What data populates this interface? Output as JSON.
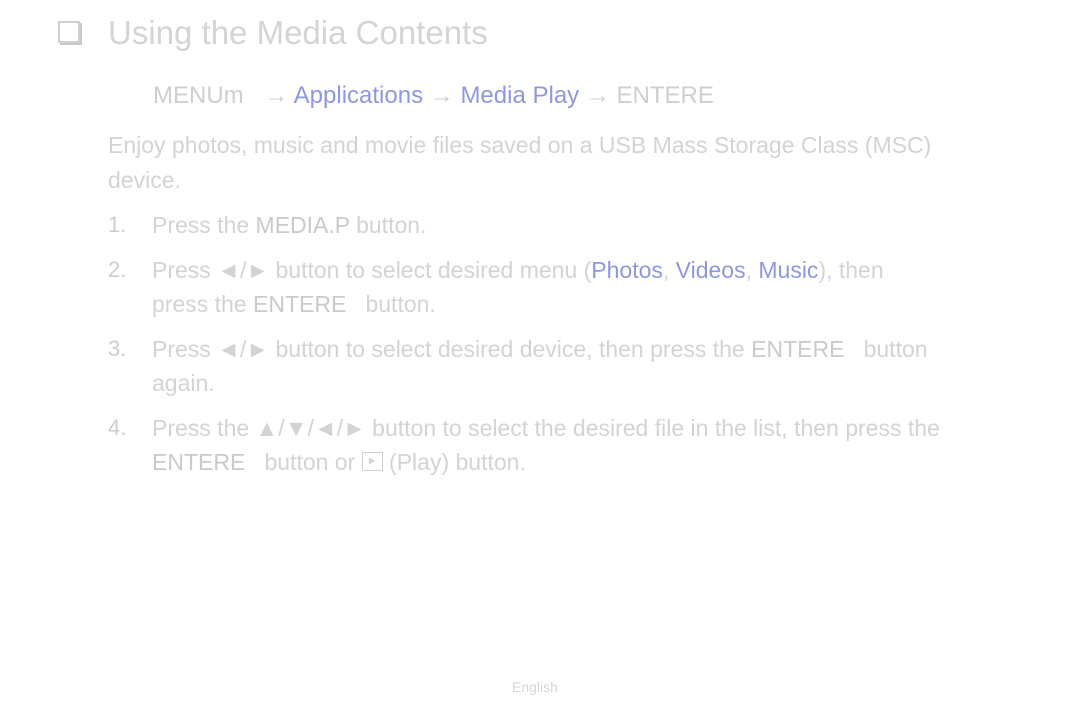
{
  "title": {
    "icon": "checkbox-square-icon",
    "text": "Using the Media Contents"
  },
  "nav_path": {
    "menu": "MENUm",
    "arrow": "→",
    "applications": "Applications",
    "media_play": "Media Play",
    "enter": "ENTERE"
  },
  "intro": {
    "line1": "Enjoy photos, music and movie files saved on a USB Mass Storage Class (MSC)",
    "line2": "device."
  },
  "steps": [
    {
      "num": "1.",
      "pre": "Press the ",
      "bold": "MEDIA.P",
      "post": " button."
    },
    {
      "num": "2.",
      "pre": "Press ◄/► button to select desired menu (",
      "photos": "Photos",
      "sep": ", ",
      "videos": "Videos",
      "music": "Music",
      "post": "), then",
      "line2_pre": "press the ",
      "line2_bold": "ENTERE",
      "line2_post": "   button."
    },
    {
      "num": "3.",
      "pre": "Press ◄/► button to select desired device, then press the ",
      "bold": "ENTERE",
      "post": "   button",
      "line2": "again."
    },
    {
      "num": "4.",
      "pre": "Press the ▲/▼/◄/► button to select the desired file in the list, then press the",
      "line2_bold": "ENTERE",
      "line2_mid": "   button or ",
      "play_icon": "►",
      "line2_post": " (Play) button."
    }
  ],
  "footer": {
    "language": "English"
  }
}
